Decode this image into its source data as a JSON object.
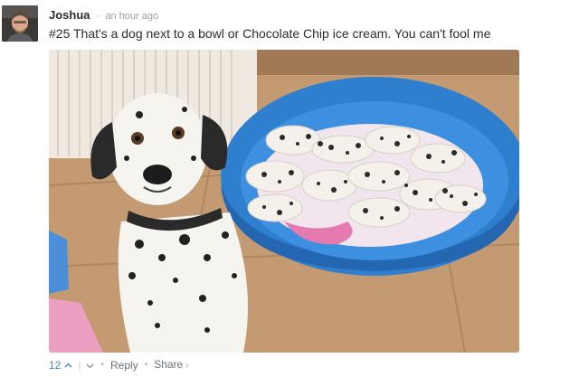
{
  "comment": {
    "author": "Joshua",
    "separator": "·",
    "timestamp": "an hour ago",
    "message": "#25 That's a dog next to a bowl or Chocolate Chip ice cream. You can't fool me",
    "avatar_icon": "user-avatar"
  },
  "actions": {
    "upvote_count": "12",
    "upvote_icon": "chevron-up-icon",
    "divider": "|",
    "downvote_icon": "chevron-down-icon",
    "bullet1": "•",
    "reply_label": "Reply",
    "bullet2": "•",
    "share_label": "Share",
    "share_chevron": "›"
  },
  "colors": {
    "accent": "#3f84c2",
    "bowl": "#2f7fcf",
    "text": "#2a2e2e",
    "meta": "#9aa0a6"
  }
}
